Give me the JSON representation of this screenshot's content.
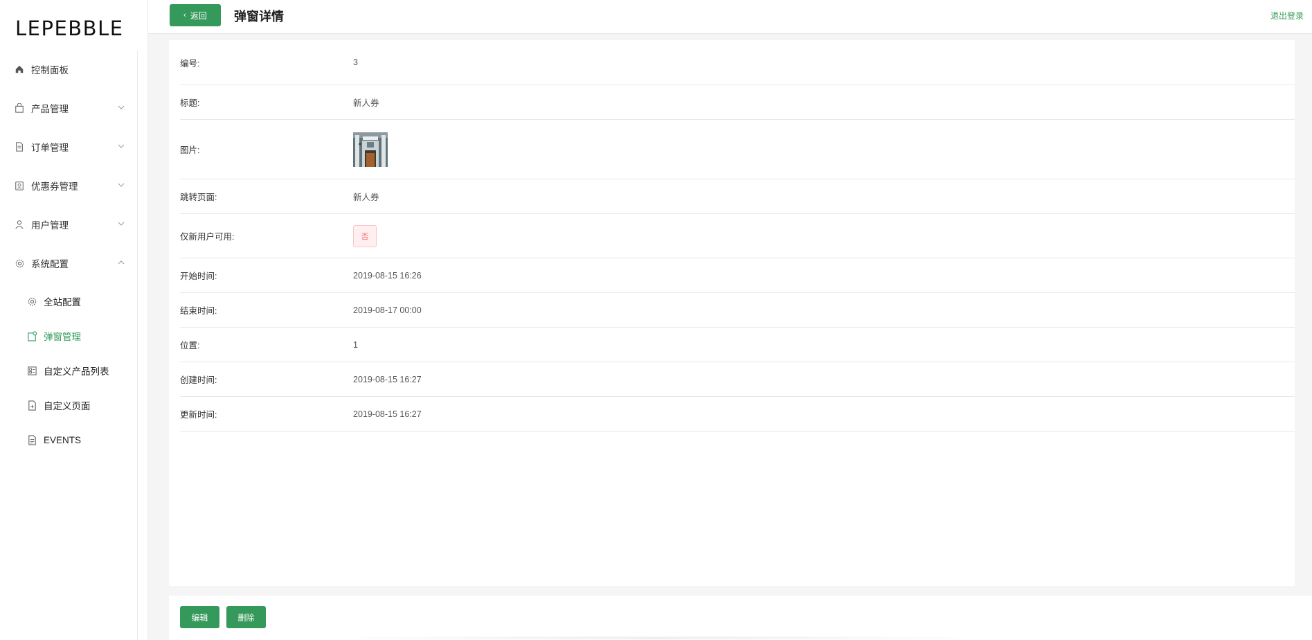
{
  "brand": {
    "logo_text": "LEPEBBLE"
  },
  "sidebar": {
    "items": [
      {
        "label": "控制面板",
        "icon": "home-icon",
        "has_chevron": false
      },
      {
        "label": "产品管理",
        "icon": "bag-icon",
        "has_chevron": true,
        "expanded": false
      },
      {
        "label": "订单管理",
        "icon": "document-icon",
        "has_chevron": true,
        "expanded": false
      },
      {
        "label": "优惠券管理",
        "icon": "coupon-icon",
        "has_chevron": true,
        "expanded": false
      },
      {
        "label": "用户管理",
        "icon": "user-icon",
        "has_chevron": true,
        "expanded": false
      },
      {
        "label": "系统配置",
        "icon": "gear-icon",
        "has_chevron": true,
        "expanded": true
      }
    ],
    "subitems": [
      {
        "label": "全站配置",
        "icon": "gear-icon",
        "active": false
      },
      {
        "label": "弹窗管理",
        "icon": "popup-icon",
        "active": true
      },
      {
        "label": "自定义产品列表",
        "icon": "list-icon",
        "active": false
      },
      {
        "label": "自定义页面",
        "icon": "page-icon",
        "active": false
      },
      {
        "label": "EVENTS",
        "icon": "document-icon",
        "active": false
      }
    ]
  },
  "header": {
    "back_label": "返回",
    "title": "弹窗详情",
    "logout_label": "退出登录"
  },
  "detail": {
    "rows": [
      {
        "label": "编号:",
        "value": "3"
      },
      {
        "label": "标题:",
        "value": "新人券"
      },
      {
        "label": "图片:",
        "value": "",
        "type": "image"
      },
      {
        "label": "跳转页面:",
        "value": "新人券"
      },
      {
        "label": "仅新用户可用:",
        "value": "否",
        "type": "tag"
      },
      {
        "label": "开始时间:",
        "value": "2019-08-15 16:26"
      },
      {
        "label": "结束时间:",
        "value": "2019-08-17 00:00"
      },
      {
        "label": "位置:",
        "value": "1"
      },
      {
        "label": "创建时间:",
        "value": "2019-08-15 16:27"
      },
      {
        "label": "更新时间:",
        "value": "2019-08-15 16:27"
      }
    ]
  },
  "footer": {
    "edit_label": "编辑",
    "delete_label": "删除"
  },
  "colors": {
    "accent": "#34995a",
    "active_text": "#2e9a5a",
    "tag_red": "#f56c6c"
  }
}
